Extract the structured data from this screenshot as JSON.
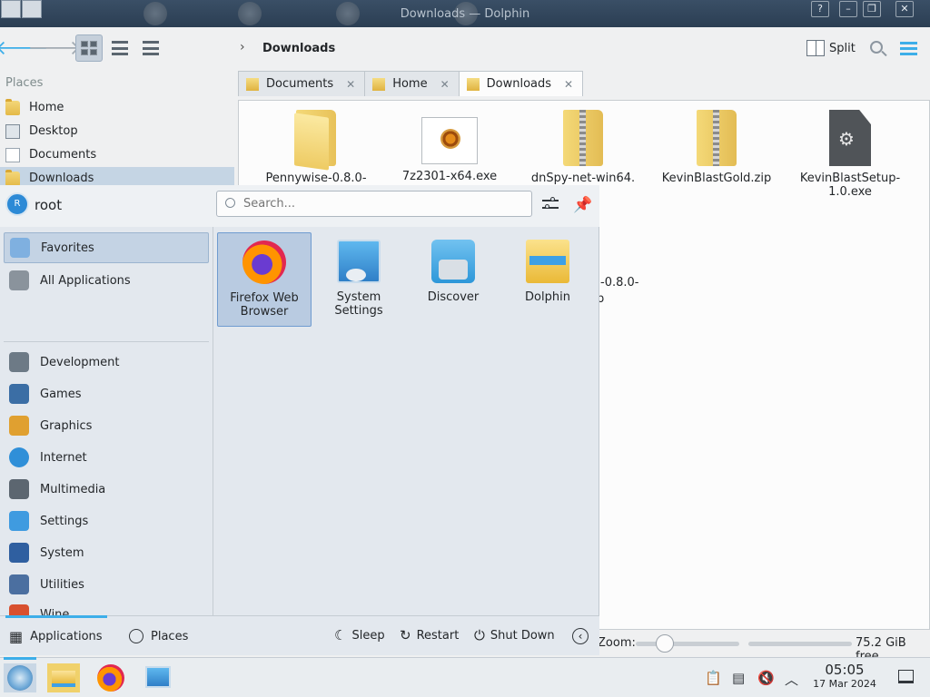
{
  "window": {
    "title": "Downloads — Dolphin",
    "help_label": "?",
    "minimize_label": "–",
    "maximize_label": "❐",
    "close_label": "✕"
  },
  "toolbar": {
    "back_label": "🡐",
    "forward_label": "🡒",
    "breadcrumb_separator": "›",
    "breadcrumb_current": "Downloads",
    "split_label": "Split"
  },
  "places": {
    "title": "Places",
    "items": [
      {
        "label": "Home"
      },
      {
        "label": "Desktop"
      },
      {
        "label": "Documents"
      },
      {
        "label": "Downloads",
        "selected": true
      }
    ]
  },
  "tabs": [
    {
      "label": "Documents",
      "close": "✕"
    },
    {
      "label": "Home",
      "close": "✕"
    },
    {
      "label": "Downloads",
      "close": "✕",
      "active": true
    }
  ],
  "files": [
    {
      "name": "Pennywise-0.8.0-",
      "kind": "folder"
    },
    {
      "name": "7z2301-x64.exe",
      "kind": "exe7z"
    },
    {
      "name": "dnSpy-net-win64.",
      "kind": "zip"
    },
    {
      "name": "KevinBlastGold.zip",
      "kind": "zip"
    },
    {
      "name": "KevinBlastSetup-1.0.exe",
      "kind": "exe"
    }
  ],
  "files_partial": {
    "line1": "-0.8.0-",
    "line2": "p"
  },
  "status": {
    "zoom_label": "Zoom:",
    "zoom_level": 0.2,
    "free_space": "75.2 GiB free"
  },
  "launcher": {
    "user": {
      "initial": "R",
      "name": "root"
    },
    "search_placeholder": "Search...",
    "categories": [
      {
        "label": "Favorites",
        "selected": true,
        "color": "#7fb0e0"
      },
      {
        "label": "All Applications",
        "color": "#8a939c"
      },
      {
        "label": "Development",
        "color": "#6d7a86"
      },
      {
        "label": "Games",
        "color": "#3b6ea5"
      },
      {
        "label": "Graphics",
        "color": "#e0a030"
      },
      {
        "label": "Internet",
        "color": "#2f8fd8"
      },
      {
        "label": "Multimedia",
        "color": "#5c6670"
      },
      {
        "label": "Settings",
        "color": "#3f9be0"
      },
      {
        "label": "System",
        "color": "#2f5fa0"
      },
      {
        "label": "Utilities",
        "color": "#4b6fa0"
      },
      {
        "label": "Wine",
        "color": "#d8502f"
      }
    ],
    "apps": [
      {
        "label_line1": "Firefox Web",
        "label_line2": "Browser",
        "icon": "firefox",
        "selected": true
      },
      {
        "label_line1": "System",
        "label_line2": "Settings",
        "icon": "settings"
      },
      {
        "label_line1": "Discover",
        "label_line2": "",
        "icon": "discover"
      },
      {
        "label_line1": "Dolphin",
        "label_line2": "",
        "icon": "dolphin"
      }
    ],
    "footer": {
      "applications_label": "Applications",
      "places_label": "Places",
      "sleep_label": "Sleep",
      "restart_label": "Restart",
      "shutdown_label": "Shut Down",
      "more_label": "‹"
    }
  },
  "panel": {
    "time": "05:05",
    "date": "17 Mar 2024",
    "accent": "#3daee9"
  }
}
